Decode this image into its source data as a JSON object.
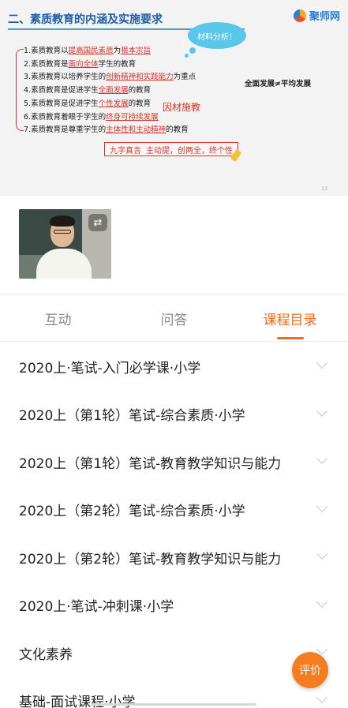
{
  "slide": {
    "title": "二、素质教育的内涵及实施要求",
    "logo": "聚师网",
    "bubble": "材料分析！",
    "points": [
      {
        "pre": "1.素质教育以",
        "hl": "提高国民素质",
        "mid": "为",
        "hl2": "根本宗旨",
        "post": ""
      },
      {
        "pre": "2.素质教育是",
        "hl": "面向全体",
        "mid": "学生的教育",
        "hl2": "",
        "post": ""
      },
      {
        "pre": "3.素质教育以培养学生的",
        "hl": "创新精神和实践能力",
        "mid": "为重点",
        "hl2": "",
        "post": ""
      },
      {
        "pre": "4.素质教育是促进学生",
        "hl": "全面发展",
        "mid": "的教育",
        "hl2": "",
        "post": ""
      },
      {
        "pre": "5.素质教育是促进学生",
        "hl": "个性发展",
        "mid": "的教育",
        "hl2": "",
        "post": ""
      },
      {
        "pre": "6.素质教育着眼于学生的",
        "hl": "终身可持续发展",
        "mid": "",
        "hl2": "",
        "post": ""
      },
      {
        "pre": "7.素质教育是尊重学生的",
        "hl": "主体性和主动精神",
        "mid": "的教育",
        "hl2": "",
        "post": ""
      }
    ],
    "note_right": "全面发展≠平均发展",
    "note_hand": "因材施教",
    "exam_label": "九字真言",
    "exam_text": "主动提，创两全，终个性",
    "page_number": "13"
  },
  "video": {
    "switch_icon": "camera-switch-icon"
  },
  "tabs": [
    {
      "label": "互动",
      "active": false
    },
    {
      "label": "问答",
      "active": false
    },
    {
      "label": "课程目录",
      "active": true
    }
  ],
  "courses": [
    "2020上·笔试-入门必学课·小学",
    "2020上（第1轮）笔试-综合素质·小学",
    "2020上（第1轮）笔试-教育教学知识与能力",
    "2020上（第2轮）笔试-综合素质·小学",
    "2020上（第2轮）笔试-教育教学知识与能力",
    "2020上·笔试-冲刺课·小学",
    "文化素养",
    "基础-面试课程·小学"
  ],
  "rate_button": "评价",
  "colors": {
    "accent": "#f26b1d",
    "highlight": "#d9322a",
    "title_blue": "#1f5fa8"
  }
}
